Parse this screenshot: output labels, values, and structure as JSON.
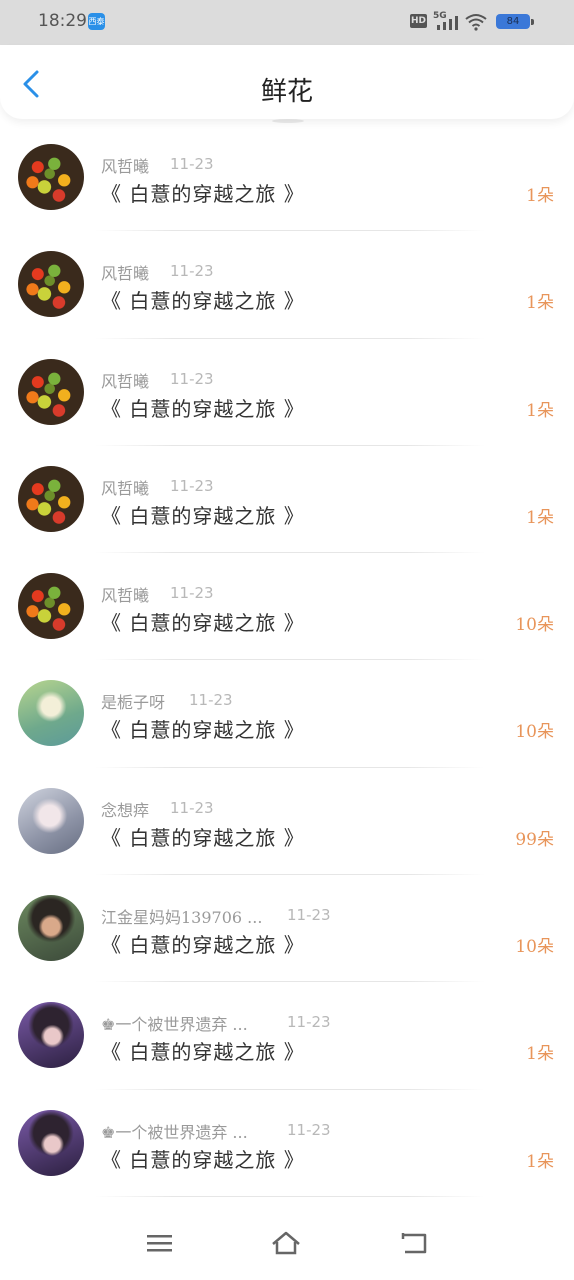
{
  "status_bar": {
    "time": "18:29",
    "app_badge": "西泰",
    "hd": "HD",
    "network": "5G",
    "battery": "84"
  },
  "header": {
    "title": "鲜花",
    "back_icon": "chevron-left-icon"
  },
  "accent_color": "#2a90e8",
  "count_color": "#e8955a",
  "items": [
    {
      "name": "风哲曦",
      "date": "11-23",
      "book": "《 白薏的穿越之旅 》",
      "count": "1朵",
      "avatar": "fruit"
    },
    {
      "name": "风哲曦",
      "date": "11-23",
      "book": "《 白薏的穿越之旅 》",
      "count": "1朵",
      "avatar": "fruit"
    },
    {
      "name": "风哲曦",
      "date": "11-23",
      "book": "《 白薏的穿越之旅 》",
      "count": "1朵",
      "avatar": "fruit"
    },
    {
      "name": "风哲曦",
      "date": "11-23",
      "book": "《 白薏的穿越之旅 》",
      "count": "1朵",
      "avatar": "fruit"
    },
    {
      "name": "风哲曦",
      "date": "11-23",
      "book": "《 白薏的穿越之旅 》",
      "count": "10朵",
      "avatar": "fruit"
    },
    {
      "name": "是栀子呀",
      "date": "11-23",
      "book": "《 白薏的穿越之旅 》",
      "count": "10朵",
      "avatar": "girl1"
    },
    {
      "name": "念想瘁",
      "date": "11-23",
      "book": "《 白薏的穿越之旅 》",
      "count": "99朵",
      "avatar": "girl2"
    },
    {
      "name": "江金星妈妈139706 ...",
      "date": "11-23",
      "book": "《 白薏的穿越之旅 》",
      "count": "10朵",
      "avatar": "woman"
    },
    {
      "name": "♚一个被世界遗弃 ...",
      "date": "11-23",
      "book": "《 白薏的穿越之旅 》",
      "count": "1朵",
      "avatar": "boy"
    },
    {
      "name": "♚一个被世界遗弃 ...",
      "date": "11-23",
      "book": "《 白薏的穿越之旅 》",
      "count": "1朵",
      "avatar": "boy"
    }
  ],
  "nav_bar": {
    "menu_icon": "menu-icon",
    "home_icon": "home-icon",
    "back_icon": "back-icon"
  }
}
